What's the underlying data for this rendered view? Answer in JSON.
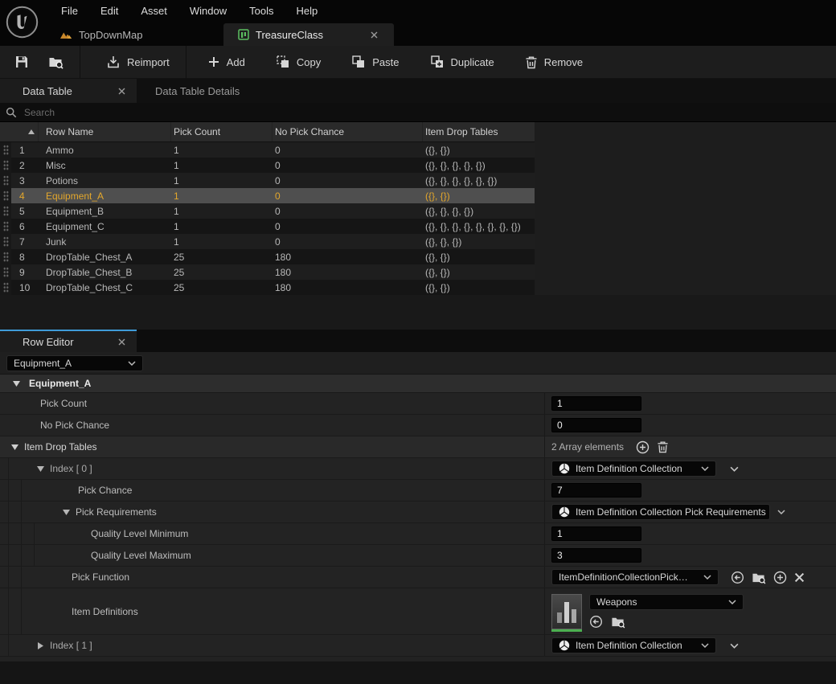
{
  "menubar": {
    "items": [
      "File",
      "Edit",
      "Asset",
      "Window",
      "Tools",
      "Help"
    ]
  },
  "asset_tabs": {
    "topdown_label": "TopDownMap",
    "treasure_label": "TreasureClass"
  },
  "toolbar": {
    "reimport": "Reimport",
    "add": "Add",
    "copy": "Copy",
    "paste": "Paste",
    "duplicate": "Duplicate",
    "remove": "Remove"
  },
  "doc_tabs": {
    "data_table": "Data Table",
    "data_table_details": "Data Table Details"
  },
  "search": {
    "placeholder": "Search"
  },
  "table": {
    "columns": [
      "Row Name",
      "Pick Count",
      "No Pick Chance",
      "Item Drop Tables"
    ],
    "selected_row": "Equipment_A",
    "rows": [
      {
        "num": "1",
        "name": "Ammo",
        "pick_count": "1",
        "no_pick_chance": "0",
        "item_drop_tables": "({}, {})"
      },
      {
        "num": "2",
        "name": "Misc",
        "pick_count": "1",
        "no_pick_chance": "0",
        "item_drop_tables": "({}, {}, {}, {}, {})"
      },
      {
        "num": "3",
        "name": "Potions",
        "pick_count": "1",
        "no_pick_chance": "0",
        "item_drop_tables": "({}, {}, {}, {}, {}, {})"
      },
      {
        "num": "4",
        "name": "Equipment_A",
        "pick_count": "1",
        "no_pick_chance": "0",
        "item_drop_tables": "({}, {})"
      },
      {
        "num": "5",
        "name": "Equipment_B",
        "pick_count": "1",
        "no_pick_chance": "0",
        "item_drop_tables": "({}, {}, {}, {})"
      },
      {
        "num": "6",
        "name": "Equipment_C",
        "pick_count": "1",
        "no_pick_chance": "0",
        "item_drop_tables": "({}, {}, {}, {}, {}, {}, {}, {})"
      },
      {
        "num": "7",
        "name": "Junk",
        "pick_count": "1",
        "no_pick_chance": "0",
        "item_drop_tables": "({}, {}, {})"
      },
      {
        "num": "8",
        "name": "DropTable_Chest_A",
        "pick_count": "25",
        "no_pick_chance": "180",
        "item_drop_tables": "({}, {})"
      },
      {
        "num": "9",
        "name": "DropTable_Chest_B",
        "pick_count": "25",
        "no_pick_chance": "180",
        "item_drop_tables": "({}, {})"
      },
      {
        "num": "10",
        "name": "DropTable_Chest_C",
        "pick_count": "25",
        "no_pick_chance": "180",
        "item_drop_tables": "({}, {})"
      }
    ]
  },
  "row_editor": {
    "tab_label": "Row Editor",
    "row_selector_value": "Equipment_A",
    "category": "Equipment_A",
    "pick_count": {
      "label": "Pick Count",
      "value": "1"
    },
    "no_pick_chance": {
      "label": "No Pick Chance",
      "value": "0"
    },
    "item_drop_tables": {
      "label": "Item Drop Tables",
      "count_text": "2 Array elements"
    },
    "index0": {
      "label": "Index [ 0 ]",
      "type": "Item Definition Collection"
    },
    "pick_chance": {
      "label": "Pick Chance",
      "value": "7"
    },
    "pick_requirements": {
      "label": "Pick Requirements",
      "type": "Item Definition Collection Pick Requirements"
    },
    "quality_level_minimum": {
      "label": "Quality Level Minimum",
      "value": "1"
    },
    "quality_level_maximum": {
      "label": "Quality Level Maximum",
      "value": "3"
    },
    "pick_function": {
      "label": "Pick Function",
      "value": "ItemDefinitionCollectionPickFunction"
    },
    "item_definitions": {
      "label": "Item Definitions",
      "value": "Weapons"
    },
    "index1": {
      "label": "Index [ 1 ]",
      "type": "Item Definition Collection"
    }
  },
  "colors": {
    "selection_bg": "#4f4f4f",
    "selection_text": "#e3a72c",
    "row_editor_tab_accent": "#3f9bd8",
    "asset_icon_green": "#5bbf60",
    "asset_icon_orange": "#c8872b",
    "thumbnail_underline_green": "#4caf50"
  }
}
